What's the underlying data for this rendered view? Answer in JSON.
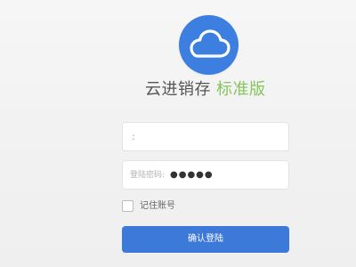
{
  "brand": {
    "main": "云进销存",
    "accent": "标准版"
  },
  "login": {
    "username_value": ":",
    "password_label": "登陆密码:",
    "password_mask": "●●●●●",
    "remember_label": "记住账号",
    "confirm_label": "确认登陆"
  },
  "icons": {
    "logo": "cloud-icon"
  },
  "colors": {
    "accent": "#86c45e",
    "primary": "#3d79d8",
    "logo_circle": "#3c7fe0"
  }
}
